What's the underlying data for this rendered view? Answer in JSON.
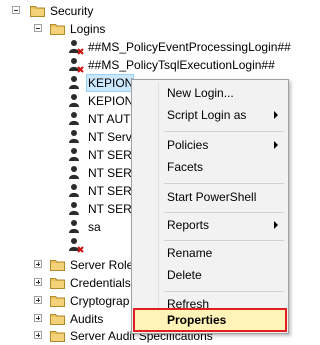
{
  "tree": {
    "security": "Security",
    "logins": "Logins",
    "login_items": [
      "##MS_PolicyEventProcessingLogin##",
      "##MS_PolicyTsqlExecutionLogin##",
      "KEPION",
      "KEPION",
      "NT AUT",
      "NT Serv",
      "NT SERV",
      "NT SERV",
      "NT SERV",
      "NT SERV",
      "sa"
    ],
    "after_items": [
      "Server Roles",
      "Credentials",
      "Cryptograp",
      "Audits",
      "Server Audit Specifications"
    ]
  },
  "context_menu": {
    "items": [
      {
        "label": "New Login..."
      },
      {
        "label": "Script Login as"
      },
      {
        "label": "Policies"
      },
      {
        "label": "Facets"
      },
      {
        "label": "Start PowerShell"
      },
      {
        "label": "Reports"
      },
      {
        "label": "Rename"
      },
      {
        "label": "Delete"
      },
      {
        "label": "Refresh"
      },
      {
        "label": "Properties"
      }
    ]
  },
  "colors": {
    "folder": "#e8c15c",
    "selection": "#cce8ff",
    "highlight_border": "#e02020",
    "highlight_bg": "#fff3b8"
  }
}
